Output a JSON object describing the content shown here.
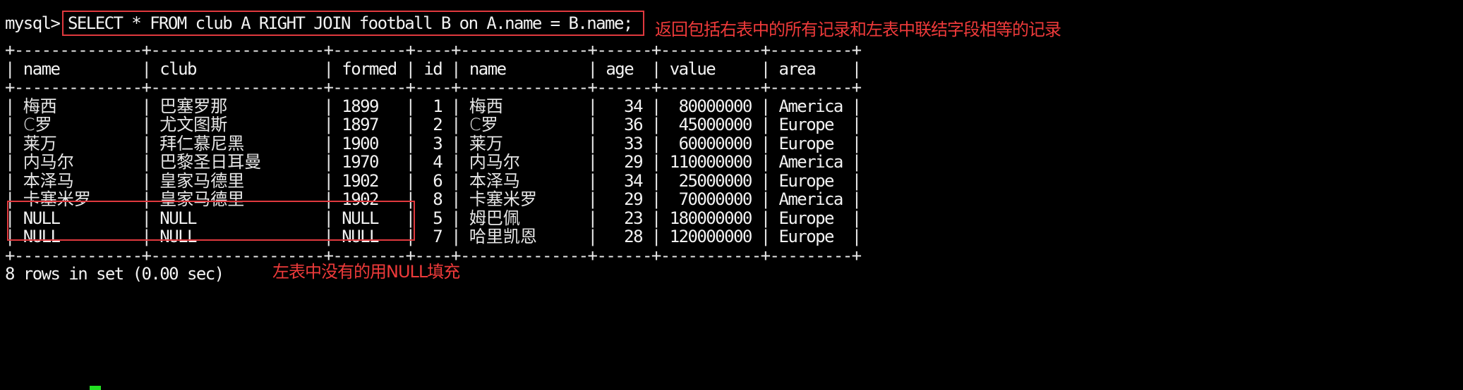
{
  "prompt": "mysql>",
  "query": "SELECT * FROM club A RIGHT JOIN football B on A.name = B.name;",
  "annotations": {
    "query_note": "返回包括右表中的所有记录和左表中联结字段相等的记录",
    "null_note": "左表中没有的用NULL填充"
  },
  "table": {
    "separator": "+--------------+-------------------+--------+----+--------------+------+-----------+---------+",
    "columns": [
      "name",
      "club",
      "formed",
      "id",
      "name",
      "age",
      "value",
      "area"
    ],
    "rows": [
      [
        "梅西",
        "巴塞罗那",
        "1899",
        "1",
        "梅西",
        "34",
        "80000000",
        "America"
      ],
      [
        "C罗",
        "尤文图斯",
        "1897",
        "2",
        "C罗",
        "36",
        "45000000",
        "Europe"
      ],
      [
        "莱万",
        "拜仁慕尼黑",
        "1900",
        "3",
        "莱万",
        "33",
        "60000000",
        "Europe"
      ],
      [
        "内马尔",
        "巴黎圣日耳曼",
        "1970",
        "4",
        "内马尔",
        "29",
        "110000000",
        "America"
      ],
      [
        "本泽马",
        "皇家马德里",
        "1902",
        "6",
        "本泽马",
        "34",
        "25000000",
        "Europe"
      ],
      [
        "卡塞米罗",
        "皇家马德里",
        "1902",
        "8",
        "卡塞米罗",
        "29",
        "70000000",
        "America"
      ],
      [
        "NULL",
        "NULL",
        "NULL",
        "5",
        "姆巴佩",
        "23",
        "180000000",
        "Europe"
      ],
      [
        "NULL",
        "NULL",
        "NULL",
        "7",
        "哈里凯恩",
        "28",
        "120000000",
        "Europe"
      ]
    ]
  },
  "footer": "8 rows in set (0.00 sec)",
  "colors": {
    "background": "#000000",
    "text": "#f2f2f2",
    "highlight_box": "#e0393e",
    "annotation": "#ee3a3a",
    "cursor": "#22e022"
  }
}
